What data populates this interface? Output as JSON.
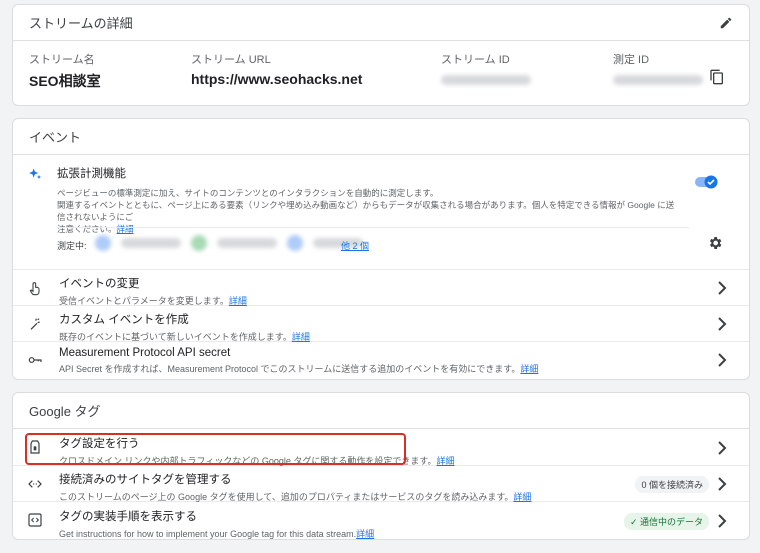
{
  "stream_card": {
    "title": "ストリームの詳細",
    "name_label": "ストリーム名",
    "name_value": "SEO相談室",
    "url_label": "ストリーム URL",
    "url_value": "https://www.seohacks.net",
    "id_label": "ストリーム ID",
    "measure_label": "測定 ID"
  },
  "events_card": {
    "title": "イベント",
    "enhanced": {
      "title": "拡張計測機能",
      "desc_line1": "ページビューの標準測定に加え、サイトのコンテンツとのインタラクションを自動的に測定します。",
      "desc_line2": "関連するイベントとともに、ページ上にある要素（リンクや埋め込み動画など）からもデータが収集される場合があります。個人を特定できる情報が Google に送信されないようにご",
      "desc_line3": "注意ください。",
      "link": "詳細",
      "measuring_label": "測定中:",
      "more_label": "他 2 個"
    },
    "rows": [
      {
        "title": "イベントの変更",
        "desc": "受信イベントとパラメータを変更します。",
        "link": "詳細"
      },
      {
        "title": "カスタム イベントを作成",
        "desc": "既存のイベントに基づいて新しいイベントを作成します。",
        "link": "詳細"
      },
      {
        "title": "Measurement Protocol API secret",
        "desc": "API Secret を作成すれば、Measurement Protocol でこのストリームに送信する追加のイベントを有効にできます。",
        "link": "詳細"
      }
    ]
  },
  "google_tag_card": {
    "title": "Google タグ",
    "rows": [
      {
        "title": "タグ設定を行う",
        "desc": "クロスドメイン リンクや内部トラフィックなどの Google タグに関する動作を設定できます。",
        "link": "詳細"
      },
      {
        "title": "接続済みのサイトタグを管理する",
        "desc": "このストリームのページ上の Google タグを使用して、追加のプロパティまたはサービスのタグを読み込みます。",
        "link": "詳細",
        "badge": "0 個を接続済み"
      },
      {
        "title": "タグの実装手順を表示する",
        "desc": "Get instructions for how to implement your Google tag for this data stream.",
        "link": "詳細",
        "badge": "✓ 通信中のデータ"
      }
    ]
  },
  "colors": {
    "accent": "#1a73e8",
    "highlight": "#d93025",
    "green": "#137333"
  }
}
